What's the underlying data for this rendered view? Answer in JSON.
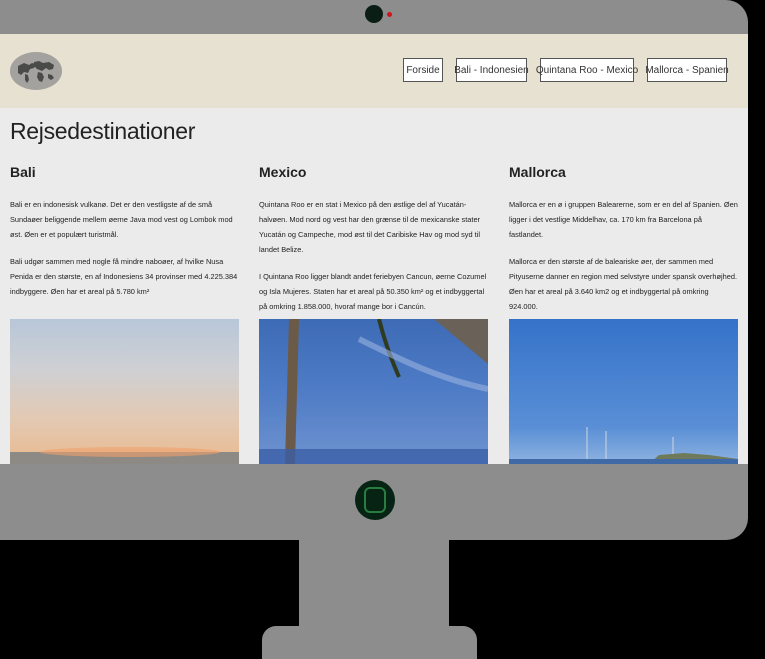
{
  "nav": {
    "forside": "Forside",
    "bali": "Bali - Indonesien",
    "quintana_roo": "Quintana Roo - Mexico",
    "mallorca": "Mallorca - Spanien"
  },
  "page_title": "Rejsedestinationer",
  "columns": [
    {
      "heading": "Bali",
      "paragraphs": [
        "Bali er en indonesisk vulkanø. Det er den vestligste af de små Sundaøer beliggende mellem øerne Java mod vest og Lombok mod øst. Øen er et populært turistmål.",
        "Bali udgør sammen med nogle få mindre naboøer, af hvilke Nusa Penida er den største, en af Indonesiens 34 provinser med 4.225.384 indbyggere. Øen har et areal på 5.780 km²"
      ]
    },
    {
      "heading": "Mexico",
      "paragraphs": [
        "Quintana Roo er en stat i Mexico på den østlige del af Yucatán-halvøen. Mod nord og vest har den grænse til de mexicanske stater Yucatán og Campeche, mod øst til det Caribiske Hav og mod syd til landet Belize.",
        "I Quintana Roo ligger blandt andet feriebyen Cancun, øerne Cozumel og Isla Mujeres. Staten har et areal på 50.350 km² og et indbyggertal på omkring 1.858.000, hvoraf mange bor i Cancún."
      ]
    },
    {
      "heading": "Mallorca",
      "paragraphs": [
        "Mallorca er en ø i gruppen Balearerne, som er en del af Spanien. Øen ligger i det vestlige Middelhav, ca. 170 km fra Barcelona på fastlandet.",
        "Mallorca er den største af de baleariske øer, der sammen med Pityuserne danner en region med selvstyre under spansk overhøjhed. Øen har et areal på 3.640 km2 og et indbyggertal på omkring 924.000."
      ]
    }
  ],
  "colors": {
    "header_bg": "#e6e1d0",
    "page_bg": "#ebebeb",
    "monitor": "#8d8d8d",
    "camera_led": "#d3131a",
    "home_button": "#062314"
  },
  "icons": [
    "world-map-logo",
    "camera-icon",
    "home-button-icon"
  ]
}
